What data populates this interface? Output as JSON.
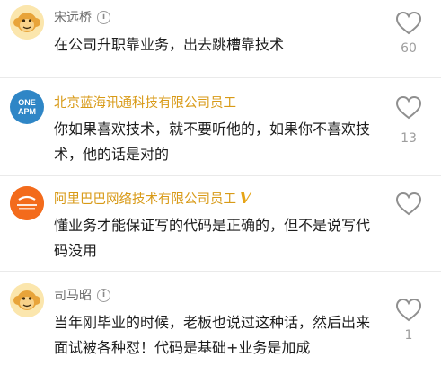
{
  "colors": {
    "accent_name": "#d89a17",
    "normal_name": "#6b6b6b",
    "count": "#9e9e9e"
  },
  "comments": [
    {
      "author": "宋远桥",
      "text": "在公司升职靠业务，出去跳槽靠技术",
      "likes": "60",
      "avatar_icon": "monkey-avatar-icon"
    },
    {
      "author": "北京蓝海讯通科技有限公司员工",
      "text": "你如果喜欢技术，就不要听他的，如果你不喜欢技术，他的话是对的",
      "likes": "13",
      "avatar_text": "ONE APM"
    },
    {
      "author": "阿里巴巴网络技术有限公司员工",
      "badge": "V",
      "text": "懂业务才能保证写的代码是正确的，但不是说写代码没用",
      "likes": "",
      "avatar_icon": "alibaba-logo-icon"
    },
    {
      "author": "司马昭",
      "text": "当年刚毕业的时候，老板也说过这种话，然后出来面试被各种怼！代码是基础+业务是加成",
      "likes": "1",
      "avatar_icon": "monkey-avatar-icon"
    }
  ]
}
